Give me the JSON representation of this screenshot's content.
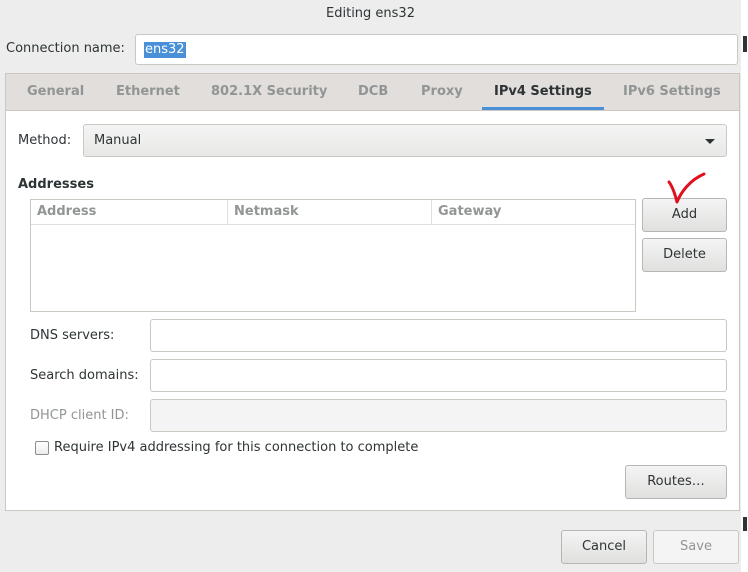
{
  "window": {
    "title": "Editing ens32"
  },
  "connection": {
    "label": "Connection name:",
    "value": "ens32"
  },
  "tabs": [
    {
      "label": "General"
    },
    {
      "label": "Ethernet"
    },
    {
      "label": "802.1X Security"
    },
    {
      "label": "DCB"
    },
    {
      "label": "Proxy"
    },
    {
      "label": "IPv4 Settings",
      "active": true
    },
    {
      "label": "IPv6 Settings"
    }
  ],
  "ipv4": {
    "method_label": "Method:",
    "method_value": "Manual",
    "addresses_heading": "Addresses",
    "columns": [
      "Address",
      "Netmask",
      "Gateway"
    ],
    "rows": [],
    "add_label": "Add",
    "delete_label": "Delete",
    "dns_label": "DNS servers:",
    "dns_value": "",
    "search_label": "Search domains:",
    "search_value": "",
    "dhcp_label": "DHCP client ID:",
    "dhcp_value": "",
    "require_label": "Require IPv4 addressing for this connection to complete",
    "require_checked": false,
    "routes_label": "Routes…"
  },
  "footer": {
    "cancel_label": "Cancel",
    "save_label": "Save"
  },
  "colors": {
    "accent": "#4a90d9",
    "annotation": "#e0101f"
  }
}
